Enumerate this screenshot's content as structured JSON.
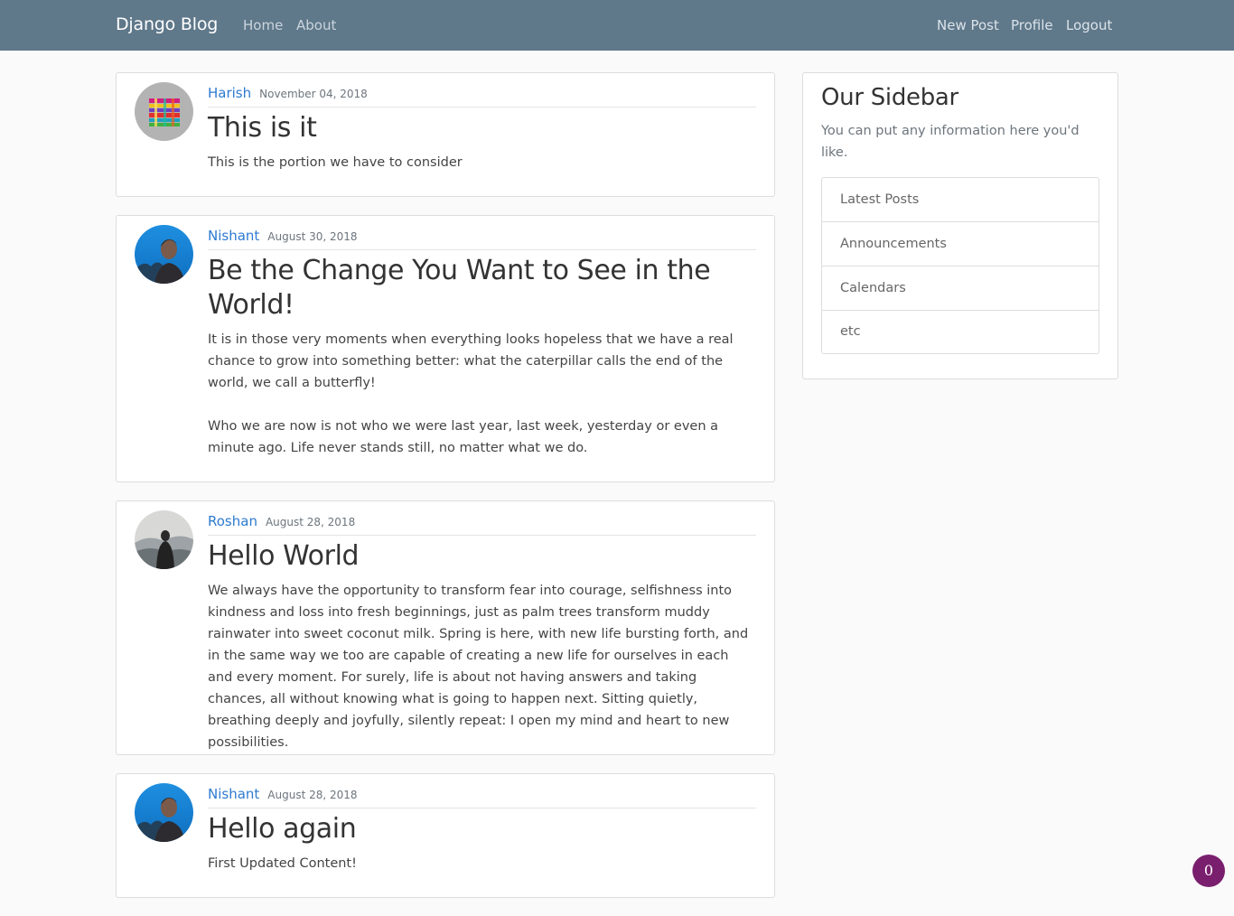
{
  "navbar": {
    "brand": "Django Blog",
    "links": [
      "Home",
      "About"
    ],
    "right_links": [
      "New Post",
      "Profile",
      "Logout"
    ]
  },
  "posts": [
    {
      "author": "Harish",
      "date": "November 04, 2018",
      "title": "This is it",
      "content": "This is the portion we have to consider",
      "avatar_icon": "pattern-avatar-icon"
    },
    {
      "author": "Nishant",
      "date": "August 30, 2018",
      "title": "Be the Change You Want to See in the World!",
      "content": "It is in those very moments when everything looks hopeless that we have a real chance to grow into something better: what the caterpillar calls the end of the world, we call a butterfly!\n\nWho we are now is not who we were last year, last week, yesterday or even a minute ago. Life never stands still, no matter what we do.",
      "avatar_icon": "portrait-avatar-icon"
    },
    {
      "author": "Roshan",
      "date": "August 28, 2018",
      "title": "Hello World",
      "content": "We always have the opportunity to transform fear into courage, selfishness into kindness and loss into fresh beginnings, just as palm trees transform muddy rainwater into sweet coconut milk. Spring is here, with new life bursting forth, and in the same way we too are capable of creating a new life for ourselves in each and every moment. For surely, life is about not having answers and taking chances, all without knowing what is going to happen next. Sitting quietly, breathing deeply and joyfully, silently repeat: I open my mind and heart to new possibilities.",
      "avatar_icon": "mountain-avatar-icon"
    },
    {
      "author": "Nishant",
      "date": "August 28, 2018",
      "title": "Hello again",
      "content": "First Updated Content!",
      "avatar_icon": "portrait-avatar-icon"
    }
  ],
  "sidebar": {
    "title": "Our Sidebar",
    "text": "You can put any information here you'd like.",
    "items": [
      "Latest Posts",
      "Announcements",
      "Calendars",
      "etc"
    ]
  },
  "badge": {
    "count": "0"
  },
  "colors": {
    "navbar": "#5f788a",
    "link": "#2d7ad0",
    "badge": "#7a1f6e"
  }
}
